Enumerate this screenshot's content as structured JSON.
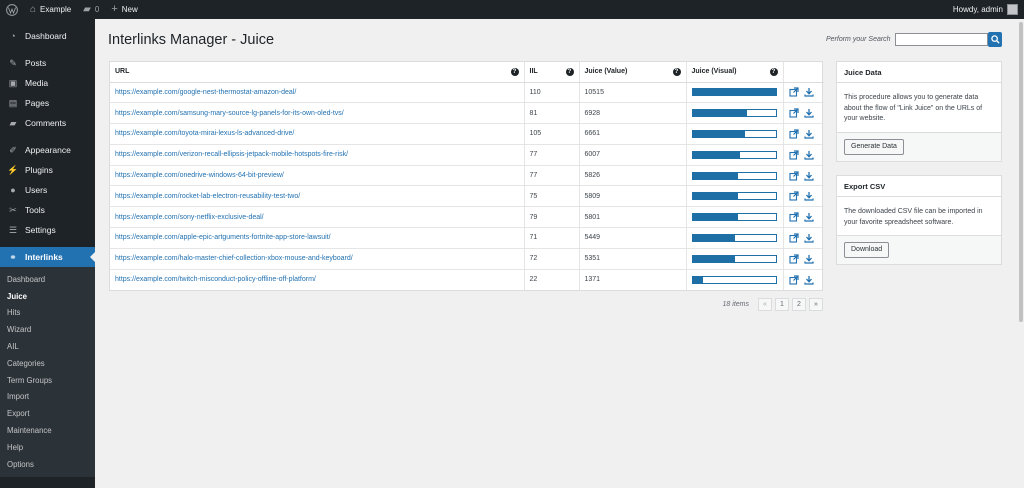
{
  "adminbar": {
    "site_name": "Example",
    "comments_count": "0",
    "new_label": "New",
    "howdy": "Howdy, admin"
  },
  "sidebar": {
    "items": [
      {
        "label": "Dashboard",
        "icon": "dashboard-icon"
      },
      {
        "label": "Posts",
        "icon": "pin-icon"
      },
      {
        "label": "Media",
        "icon": "media-icon"
      },
      {
        "label": "Pages",
        "icon": "pages-icon"
      },
      {
        "label": "Comments",
        "icon": "comments-icon"
      },
      {
        "label": "Appearance",
        "icon": "brush-icon"
      },
      {
        "label": "Plugins",
        "icon": "plugin-icon"
      },
      {
        "label": "Users",
        "icon": "users-icon"
      },
      {
        "label": "Tools",
        "icon": "wrench-icon"
      },
      {
        "label": "Settings",
        "icon": "settings-icon"
      },
      {
        "label": "Interlinks",
        "icon": "link-icon"
      }
    ],
    "submenu": [
      "Dashboard",
      "Juice",
      "Hits",
      "Wizard",
      "AIL",
      "Categories",
      "Term Groups",
      "Import",
      "Export",
      "Maintenance",
      "Help",
      "Options"
    ]
  },
  "page": {
    "title": "Interlinks Manager - Juice",
    "search_label": "Perform your Search",
    "search_placeholder": ""
  },
  "table": {
    "headers": {
      "url": "URL",
      "iil": "IIL",
      "juice_value": "Juice (Value)",
      "juice_visual": "Juice (Visual)"
    },
    "rows": [
      {
        "url": "https://example.com/google-nest-thermostat-amazon-deal/",
        "iil": "110",
        "juice": "10515",
        "ratio": 1.0
      },
      {
        "url": "https://example.com/samsung-mary-source-lg-panels-for-its-own-oled-tvs/",
        "iil": "81",
        "juice": "6928",
        "ratio": 0.659
      },
      {
        "url": "https://example.com/toyota-mirai-lexus-ls-advanced-drive/",
        "iil": "105",
        "juice": "6661",
        "ratio": 0.633
      },
      {
        "url": "https://example.com/verizon-recall-ellipsis-jetpack-mobile-hotspots-fire-risk/",
        "iil": "77",
        "juice": "6007",
        "ratio": 0.571
      },
      {
        "url": "https://example.com/onedrive-windows-64-bit-preview/",
        "iil": "77",
        "juice": "5826",
        "ratio": 0.554
      },
      {
        "url": "https://example.com/rocket-lab-electron-reusability-test-two/",
        "iil": "75",
        "juice": "5809",
        "ratio": 0.552
      },
      {
        "url": "https://example.com/sony-netflix-exclusive-deal/",
        "iil": "79",
        "juice": "5801",
        "ratio": 0.552
      },
      {
        "url": "https://example.com/apple-epic-artguments-fortnite-app-store-lawsuit/",
        "iil": "71",
        "juice": "5449",
        "ratio": 0.518
      },
      {
        "url": "https://example.com/halo-master-chief-collection-xbox-mouse-and-keyboard/",
        "iil": "72",
        "juice": "5351",
        "ratio": 0.509
      },
      {
        "url": "https://example.com/twitch-misconduct-policy-offline-off-platform/",
        "iil": "22",
        "juice": "1371",
        "ratio": 0.13
      }
    ]
  },
  "pagination": {
    "items": "18 items",
    "prev": "«",
    "page1": "1",
    "page2": "2",
    "next": "»"
  },
  "juice_box": {
    "title": "Juice Data",
    "body": "This procedure allows you to generate data about the flow of \"Link Juice\" on the URLs of your website.",
    "button": "Generate Data"
  },
  "export_box": {
    "title": "Export CSV",
    "body": "The downloaded CSV file can be imported in your favorite spreadsheet software.",
    "button": "Download"
  },
  "colors": {
    "accent": "#2271b1",
    "bar": "#1d6fa5",
    "admin_dark": "#1d2327"
  }
}
